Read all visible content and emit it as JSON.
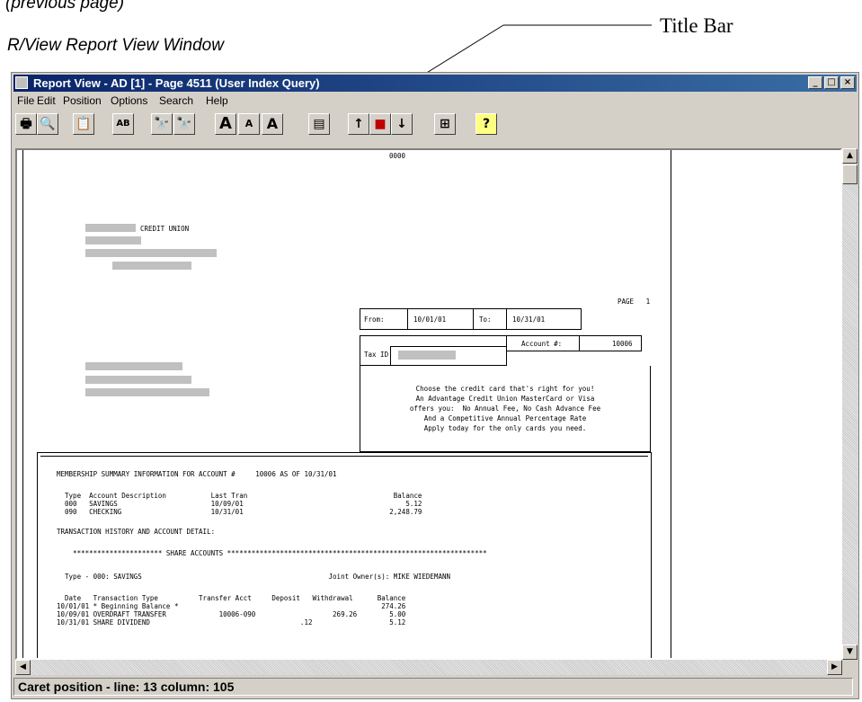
{
  "doc": {
    "caption_prev": "(previous page)",
    "caption_window": "R/View Report View Window",
    "callout_title_bar": "Title Bar"
  },
  "window": {
    "title": "Report View - AD [1] - Page 4511  (User Index Query)",
    "min": "_",
    "max": "□",
    "close": "×"
  },
  "menu": [
    "File",
    "Edit",
    "Position",
    "Options",
    "Search",
    "Help"
  ],
  "toolbar": {
    "buttons": [
      {
        "name": "print-button",
        "glyph": "🖶"
      },
      {
        "name": "print-preview-button",
        "glyph": "🔍"
      },
      {
        "name": "clipboard-button",
        "glyph": "📋"
      },
      {
        "name": "spell-button",
        "glyph": "AB"
      },
      {
        "name": "find-button",
        "glyph": "🔭"
      },
      {
        "name": "find-next-button",
        "glyph": "🔭"
      },
      {
        "name": "font-large-button",
        "glyph": "A"
      },
      {
        "name": "font-small-button",
        "glyph": "A"
      },
      {
        "name": "font-toggle-button",
        "glyph": "A"
      },
      {
        "name": "index-button",
        "glyph": "▤"
      },
      {
        "name": "page-up-button",
        "glyph": "↑"
      },
      {
        "name": "stop-button",
        "glyph": "■"
      },
      {
        "name": "page-down-button",
        "glyph": "↓"
      },
      {
        "name": "grid-button",
        "glyph": "⊞"
      },
      {
        "name": "help-button",
        "glyph": "?"
      }
    ]
  },
  "report": {
    "top_num": "0000",
    "credit_union": "CREDIT UNION",
    "page_label": "PAGE   1",
    "from_label": "From:",
    "from_date": "10/01/01",
    "to_label": "To:",
    "to_date": "10/31/01",
    "account_label": "Account #:",
    "account_no": "10006",
    "tax_label": "Tax ID #:",
    "promo": "Choose the credit card that's right for you!\nAn Advantage Credit Union MasterCard or Visa\noffers you:  No Annual Fee, No Cash Advance Fee\nAnd a Competitive Annual Percentage Rate\nApply today for the only cards you need.",
    "summary_header": "MEMBERSHIP SUMMARY INFORMATION FOR ACCOUNT #     10006 AS OF 10/31/01",
    "cols_line": "  Type  Account Description           Last Tran                                    Balance",
    "acct_rows": [
      "  000   SAVINGS                       10/09/01                                        5.12",
      "  090   CHECKING                      10/31/01                                    2,248.79"
    ],
    "txn_header": "TRANSACTION HISTORY AND ACCOUNT DETAIL:",
    "stars_line": "    ********************** SHARE ACCOUNTS ****************************************************************",
    "type_line": "  Type - 000: SAVINGS                                              Joint Owner(s): MIKE WIEDEMANN",
    "txn_cols": "  Date   Transaction Type          Transfer Acct     Deposit   Withdrawal      Balance",
    "txn_rows": [
      "10/01/01 * Beginning Balance *                                                  274.26",
      "10/09/01 OVERDRAFT TRANSFER             10006-090                   269.26        5.00",
      "10/31/01 SHARE DIVIDEND                                     .12                   5.12"
    ]
  },
  "status": {
    "caret": "Caret position - line: 13      column: 105"
  }
}
